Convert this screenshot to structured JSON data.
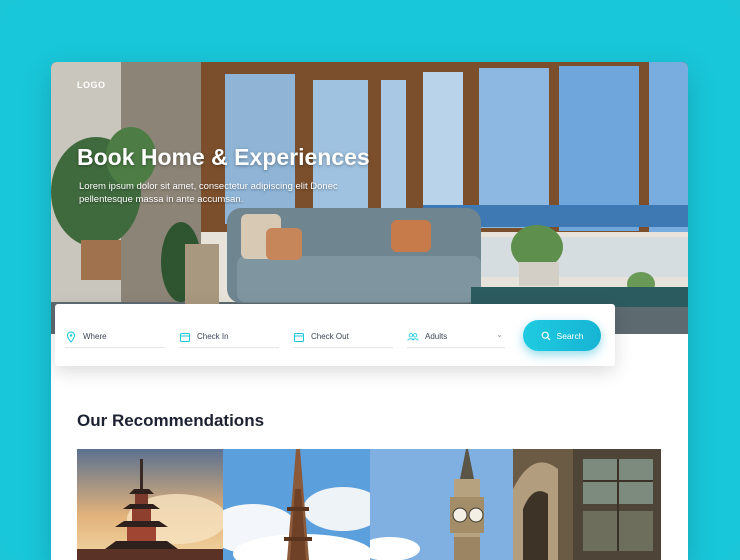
{
  "hero": {
    "logo": "LOGO",
    "title": "Book Home & Experiences",
    "subtitle": "Lorem ipsum dolor sit amet, consectetur adipiscing elit Donec pellentesque massa in ante accumsan."
  },
  "search": {
    "where_label": "Where",
    "checkin_label": "Check In",
    "checkout_label": "Check Out",
    "adults_label": "Adults",
    "button_label": "Search"
  },
  "recommendations": {
    "title": "Our Recommendations",
    "cards": [
      {
        "name": "pagoda-sunset"
      },
      {
        "name": "eiffel-tower"
      },
      {
        "name": "big-ben"
      },
      {
        "name": "cathedral-interior"
      }
    ]
  },
  "colors": {
    "accent": "#19c7da",
    "button": "#16b4d4",
    "title": "#1d2233"
  }
}
